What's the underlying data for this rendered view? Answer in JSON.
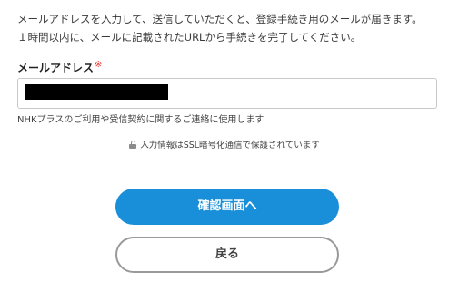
{
  "intro": {
    "line1": "メールアドレスを入力して、送信していただくと、登録手続き用のメールが届きます。",
    "line2": "１時間以内に、メールに記載されたURLから手続きを完了してください。"
  },
  "email": {
    "label": "メールアドレス",
    "required_mark": "※",
    "value_redacted": true,
    "note": "NHKプラスのご利用や受信契約に関するご連絡に使用します"
  },
  "security": {
    "icon": "lock-icon",
    "text": "入力情報はSSL暗号化通信で保護されています"
  },
  "buttons": {
    "confirm_label": "確認画面へ",
    "back_label": "戻る"
  },
  "colors": {
    "primary": "#1a8fd9",
    "required": "#e8382e",
    "border": "#c9c9c9"
  }
}
